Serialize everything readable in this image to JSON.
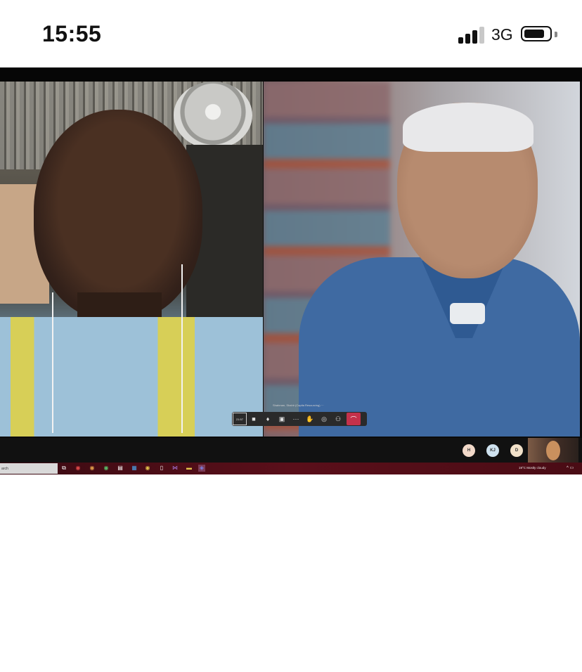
{
  "status_bar": {
    "time": "15:55",
    "network": "3G",
    "signal_bars": 3,
    "battery_level": 0.7
  },
  "teams_call": {
    "caller_label": "Shahman, Shahir (Capita Resourcing) ···",
    "toolbar": {
      "elapsed": "21:57",
      "buttons": [
        "camera-icon",
        "microphone-icon",
        "share-screen-icon",
        "more-icon",
        "raise-hand-icon",
        "chat-icon",
        "participants-icon",
        "hang-up-icon"
      ],
      "hangup_color": "#c4314b"
    },
    "participants": [
      {
        "initials": "H",
        "color": "#f2d9c9"
      },
      {
        "initials": "KJ",
        "color": "#cfe2ef"
      },
      {
        "initials": "D",
        "color": "#f2e1c9"
      }
    ]
  },
  "taskbar": {
    "search_text": "arch",
    "weather": "19°C  Mostly cloudy",
    "apps": [
      "task-view-icon",
      "chrome-icon",
      "chrome-icon",
      "chrome-icon",
      "news-icon",
      "outlook-icon",
      "chrome-icon",
      "file-icon",
      "visual-studio-icon",
      "file-explorer-icon",
      "teams-icon"
    ]
  }
}
